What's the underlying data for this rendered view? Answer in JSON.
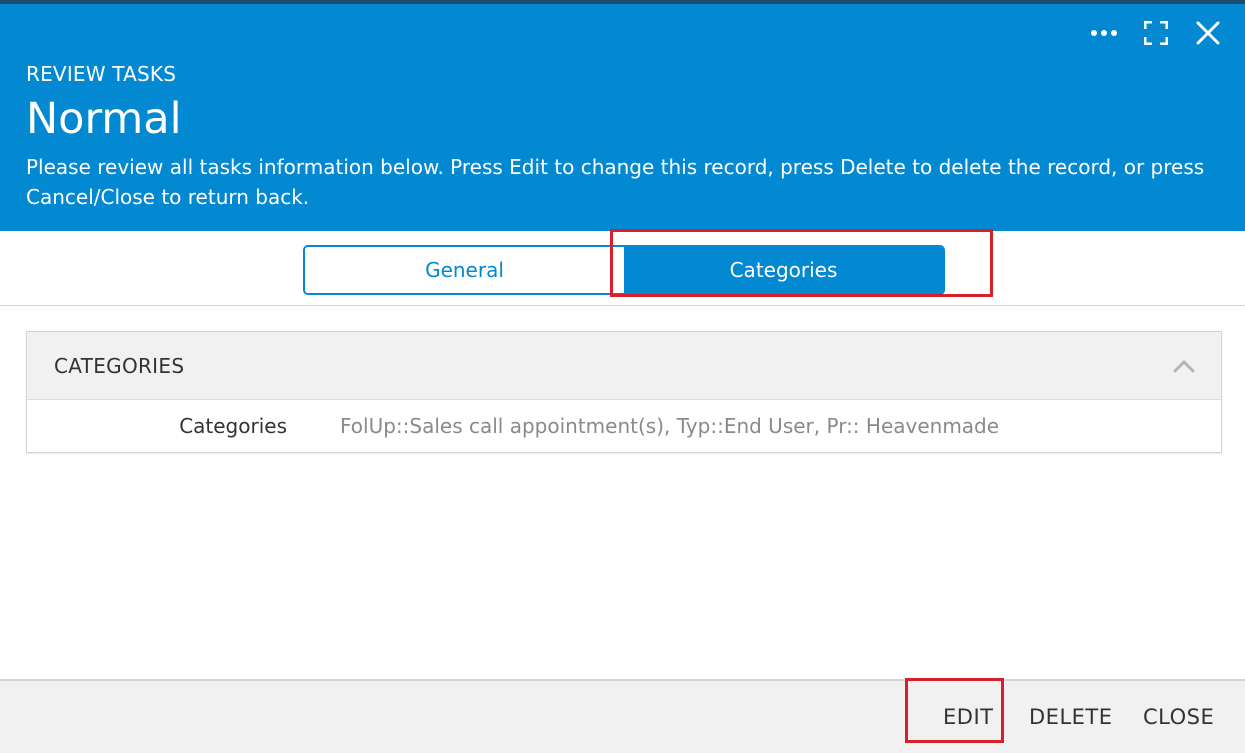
{
  "header": {
    "subtitle": "REVIEW TASKS",
    "title": "Normal",
    "description": "Please review all tasks information below. Press Edit to change this record, press Delete to delete the record, or press Cancel/Close to return back.",
    "bg_color": "#0388d2",
    "icons": [
      "more-icon",
      "fullscreen-icon",
      "close-icon"
    ]
  },
  "tabs": [
    {
      "label": "General",
      "active": false
    },
    {
      "label": "Categories",
      "active": true
    }
  ],
  "section": {
    "title": "CATEGORIES",
    "rows": [
      {
        "label": "Categories",
        "value": "FolUp::Sales call appointment(s), Typ::End User, Pr:: Heavenmade"
      }
    ]
  },
  "footer": {
    "edit_label": "EDIT",
    "delete_label": "DELETE",
    "close_label": "CLOSE"
  },
  "highlight_color": "#d8202a"
}
